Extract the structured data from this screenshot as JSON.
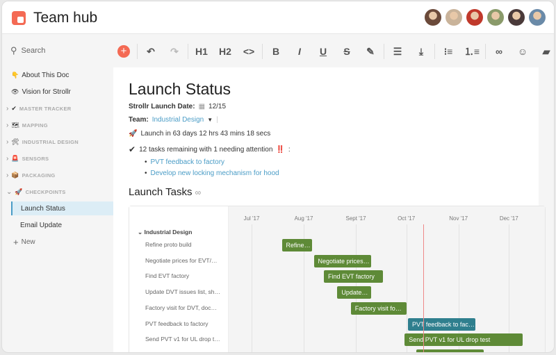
{
  "app": {
    "title": "Team hub"
  },
  "toolbar": {
    "search_placeholder": "Search",
    "icons": [
      "add",
      "undo",
      "redo",
      "heading-1",
      "heading-2",
      "code",
      "bold",
      "italic",
      "underline",
      "strikethrough",
      "highlight",
      "align-left",
      "align-bottom",
      "bulleted-list",
      "numbered-list",
      "link",
      "emoji",
      "comment"
    ],
    "labels": {
      "h1": "H1",
      "h2": "H2"
    }
  },
  "avatars": [
    "#6b4a3a",
    "#c9b39a",
    "#c0392b",
    "#8a9a6a",
    "#4a3a3a",
    "#6a8aa8"
  ],
  "sidebar": {
    "items": [
      {
        "label": "About This Doc",
        "emoji": "👇",
        "type": "page"
      },
      {
        "label": "Vision for Strollr",
        "emoji": "👁",
        "type": "page"
      },
      {
        "label": "MASTER TRACKER",
        "emoji": "✔",
        "type": "section"
      },
      {
        "label": "MAPPING",
        "emoji": "🗺",
        "type": "section"
      },
      {
        "label": "INDUSTRIAL DESIGN",
        "emoji": "🛠",
        "type": "section"
      },
      {
        "label": "SENSORS",
        "emoji": "🚨",
        "type": "section"
      },
      {
        "label": "PACKAGING",
        "emoji": "📦",
        "type": "section"
      },
      {
        "label": "CHECKPOINTS",
        "emoji": "🚀",
        "type": "section-open"
      },
      {
        "label": "Launch Status",
        "type": "sub-active"
      },
      {
        "label": "Email Update",
        "type": "sub"
      }
    ],
    "new_label": "New"
  },
  "doc": {
    "title": "Launch Status",
    "date_label": "Strollr Launch Date:",
    "date_value": "12/15",
    "team_label": "Team:",
    "team_value": "Industrial Design",
    "countdown": "Launch in 63 days 12 hrs 43 mins 18 secs",
    "tasks_summary": "12 tasks remaining with 1 needing attention",
    "attention": "‼️",
    "colon": ":",
    "links": [
      "PVT feedback to factory",
      "Develop new locking mechanism for hood"
    ],
    "section_title": "Launch Tasks"
  },
  "chart_data": {
    "type": "gantt",
    "group": "Industrial Design",
    "months": [
      {
        "label": "Jul '17",
        "day": 0
      },
      {
        "label": "Aug '17",
        "day": 31
      },
      {
        "label": "Sept '17",
        "day": 62
      },
      {
        "label": "Oct '17",
        "day": 92
      },
      {
        "label": "Nov '17",
        "day": 123
      },
      {
        "label": "Dec '17",
        "day": 153
      }
    ],
    "today_day": 102,
    "tasks": [
      {
        "name": "Refine proto build",
        "bar": "Refine…",
        "start": 18,
        "end": 36,
        "color": "#5e8a37"
      },
      {
        "name": "Negotiate prices for EVT/…",
        "bar": "Negotiate prices…",
        "start": 37,
        "end": 71,
        "color": "#5e8a37"
      },
      {
        "name": "Find EVT factory",
        "bar": "Find EVT factory",
        "start": 43,
        "end": 78,
        "color": "#5e8a37"
      },
      {
        "name": "Update DVT issues list, sh…",
        "bar": "Update…",
        "start": 51,
        "end": 71,
        "color": "#5e8a37"
      },
      {
        "name": "Factory visit for DVT, doc…",
        "bar": "Factory visit fo…",
        "start": 59,
        "end": 92,
        "color": "#5e8a37"
      },
      {
        "name": "PVT feedback to factory",
        "bar": "PVT feedback to fac…",
        "start": 93,
        "end": 133,
        "color": "#2f7f8e"
      },
      {
        "name": "Send PVT v1 for UL drop t…",
        "bar": "Send PVT v1 for UL drop test",
        "start": 91,
        "end": 161,
        "color": "#5e8a37"
      },
      {
        "name": "",
        "bar": "",
        "start": 98,
        "end": 138,
        "color": "#5e8a37"
      }
    ]
  }
}
